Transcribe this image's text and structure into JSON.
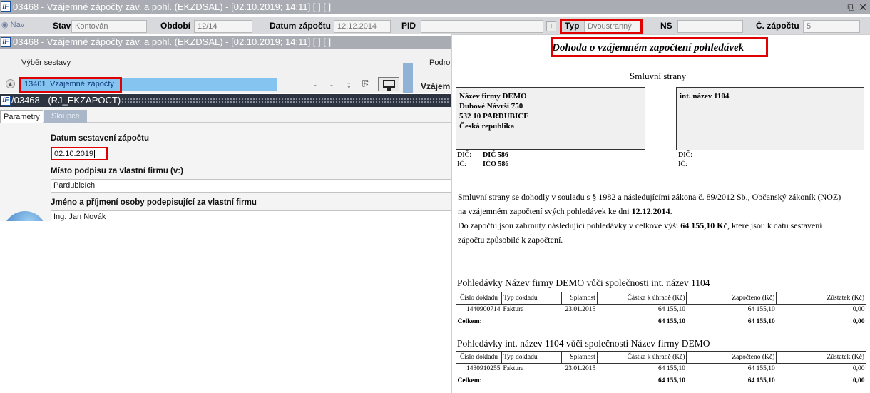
{
  "window": {
    "logo": "IF",
    "title": "03468 - Vzájemné zápočty záv. a pohl. (EKZDSAL) - [02.10.2019; 14:11]  [ ]  [ ]"
  },
  "header_fields": {
    "nav": "Nav",
    "stav_label": "Stav",
    "stav_value": "Kontován",
    "obdobi_label": "Období",
    "obdobi_value": "12/14",
    "datum_label": "Datum zápočtu",
    "datum_value": "12.12.2014",
    "pid_label": "PID",
    "pid_value": "",
    "plus": "+",
    "typ_label": "Typ",
    "typ_value": "Dvoustranný",
    "ns_label": "NS",
    "ns_value": "",
    "cislo_label": "Č. zápočtu",
    "cislo_value": "5"
  },
  "inner_window": {
    "title": "03468 - Vzájemné zápočty záv. a pohl. (EKZDSAL) - [02.10.2019; 14:11]  [ ]  [ ]"
  },
  "report_select": {
    "group_label": "Výběr sestavy",
    "group2_label": "Podro",
    "side_label": "Vzájem",
    "report_code": "13401",
    "report_name": "Vzájemné zápočty",
    "tb_dash1": "-",
    "tb_dash2": "-",
    "tb_arrows": "↕",
    "tb_pdf": "⎘"
  },
  "report_window": {
    "title": "/03468 - (RJ_EKZAPOCT)"
  },
  "tabs": {
    "parametry": "Parametry",
    "sloupce": "Sloupce"
  },
  "form": {
    "date_label": "Datum sestavení zápočtu",
    "date_value": "02.10.2019",
    "place_label": "Místo podpisu za vlastní firmu (v:)",
    "place_value": "Pardubicích",
    "name_label": "Jméno a příjmení osoby podepisující za vlastní firmu",
    "name_value": "Ing. Jan Novák"
  },
  "document": {
    "title": "Dohoda o vzájemném započtení pohledávek",
    "subtitle": "Smluvní strany",
    "party1": {
      "line1": "Název firmy DEMO",
      "line2": "Dubové Návrší 750",
      "line3": "532 10 PARDUBICE",
      "line4": "Česká republika",
      "dic_label": "DIČ:",
      "dic_value": "DIČ 586",
      "ic_label": "IČ:",
      "ic_value": "IČO 586"
    },
    "party2": {
      "line1": "int. název 1104",
      "dic_label": "DIČ:",
      "ic_label": "IČ:"
    },
    "paragraph1_a": "Smluvní strany se dohodly v souladu s § 1982 a následujícími zákona č. 89/2012 Sb., Občanský zákoník (NOZ)",
    "paragraph1_b": "na vzájemném započtení svých pohledávek ke dni ",
    "paragraph1_date": "12.12.2014",
    "paragraph1_end": ".",
    "paragraph2_a": "Do zápočtu jsou zahrnuty následující pohledávky v celkové výši ",
    "paragraph2_amount": "64 155,10 Kč",
    "paragraph2_b": ", které jsou k datu sestavení",
    "paragraph2_c": "zápočtu způsobilé k započtení.",
    "section1": {
      "title": "Pohledávky Název firmy DEMO vůči společnosti int. název 1104",
      "headers": [
        "Číslo dokladu",
        "Typ dokladu",
        "Splatnost",
        "Částka k úhradě (Kč)",
        "Započteno (Kč)",
        "Zůstatek (Kč)"
      ],
      "rows": [
        [
          "1440900714",
          "Faktura",
          "23.01.2015",
          "64 155,10",
          "64 155,10",
          "0,00"
        ]
      ],
      "total_label": "Celkem:",
      "total_amount": "64 155,10",
      "total_offset": "64 155,10",
      "total_balance": "0,00"
    },
    "section2": {
      "title": "Pohledávky int. název 1104 vůči společnosti Název firmy DEMO",
      "headers": [
        "Číslo dokladu",
        "Typ dokladu",
        "Splatnost",
        "Částka k úhradě (Kč)",
        "Započteno (Kč)",
        "Zůstatek (Kč)"
      ],
      "rows": [
        [
          "1430910255",
          "Faktura",
          "23.01.2015",
          "64 155,10",
          "64 155,10",
          "0,00"
        ]
      ],
      "total_label": "Celkem:",
      "total_amount": "64 155,10",
      "total_offset": "64 155,10",
      "total_balance": "0,00"
    }
  },
  "colors": {
    "highlight": "#e00000",
    "titlebar": "#a9adb3",
    "report_selection": "#85c3f0"
  }
}
